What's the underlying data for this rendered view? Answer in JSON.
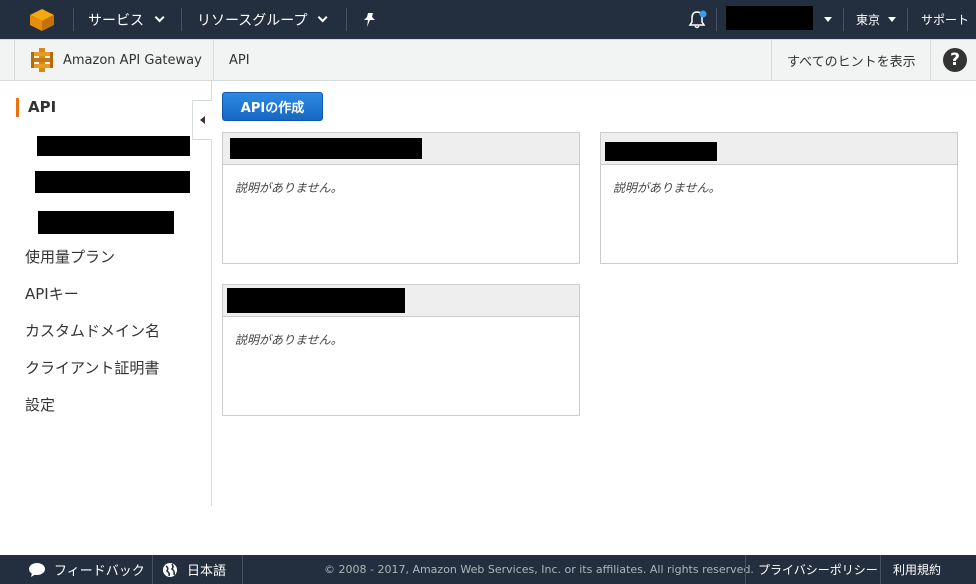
{
  "topnav": {
    "services_label": "サービス",
    "resource_groups_label": "リソースグループ",
    "region_label": "東京",
    "support_label": "サポート",
    "colors": {
      "bg": "#232f3e",
      "notification_dot": "#3b9cf2"
    }
  },
  "subbar": {
    "service_name": "Amazon API Gateway",
    "section": "API",
    "hints_label": "すべてのヒントを表示",
    "help_icon_text": "?"
  },
  "sidebar": {
    "active_item": "API",
    "items": [
      "使用量プラン",
      "APIキー",
      "カスタムドメイン名",
      "クライアント証明書",
      "設定"
    ],
    "accent_color": "#ec7211"
  },
  "main": {
    "create_button_label": "APIの作成",
    "cards": [
      {
        "description": "説明がありません。"
      },
      {
        "description": "説明がありません。"
      },
      {
        "description": "説明がありません。"
      }
    ]
  },
  "footer": {
    "feedback_label": "フィードバック",
    "language_label": "日本語",
    "copyright": "© 2008 - 2017, Amazon Web Services, Inc. or its affiliates. All rights reserved.",
    "privacy_label": "プライバシーポリシー",
    "terms_label": "利用規約"
  }
}
